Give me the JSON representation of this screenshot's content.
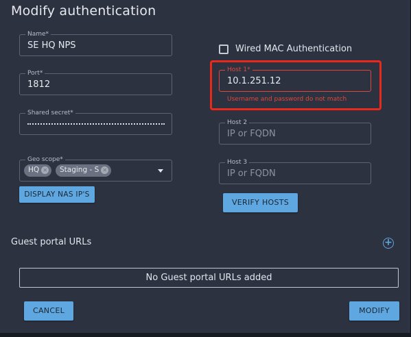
{
  "dialog": {
    "title": "Modify authentication"
  },
  "form": {
    "name": {
      "label": "Name*",
      "value": "SE HQ NPS"
    },
    "port": {
      "label": "Port*",
      "value": "1812"
    },
    "shared_secret": {
      "label": "Shared secret*"
    },
    "geo_scope": {
      "label": "Geo scope*",
      "chips": [
        "HQ",
        "Staging - S"
      ]
    },
    "display_nas_button": "DISPLAY NAS IP'S",
    "wired_mac": {
      "label": "Wired MAC Authentication",
      "checked": false
    },
    "host1": {
      "label": "Host 1*",
      "value": "10.1.251.12",
      "error": "Username and password do not match"
    },
    "host2": {
      "label": "Host 2",
      "placeholder": "IP or FQDN"
    },
    "host3": {
      "label": "Host 3",
      "placeholder": "IP or FQDN"
    },
    "verify_hosts_button": "VERIFY HOSTS"
  },
  "guest_portal": {
    "title": "Guest portal URLs",
    "empty_text": "No Guest portal URLs added",
    "add_icon": "plus-circle-icon"
  },
  "footer": {
    "cancel_label": "CANCEL",
    "modify_label": "MODIFY"
  },
  "colors": {
    "background": "#2c3240",
    "accent": "#5ea7e0",
    "error": "#e0483c",
    "highlight": "#e8291c"
  }
}
